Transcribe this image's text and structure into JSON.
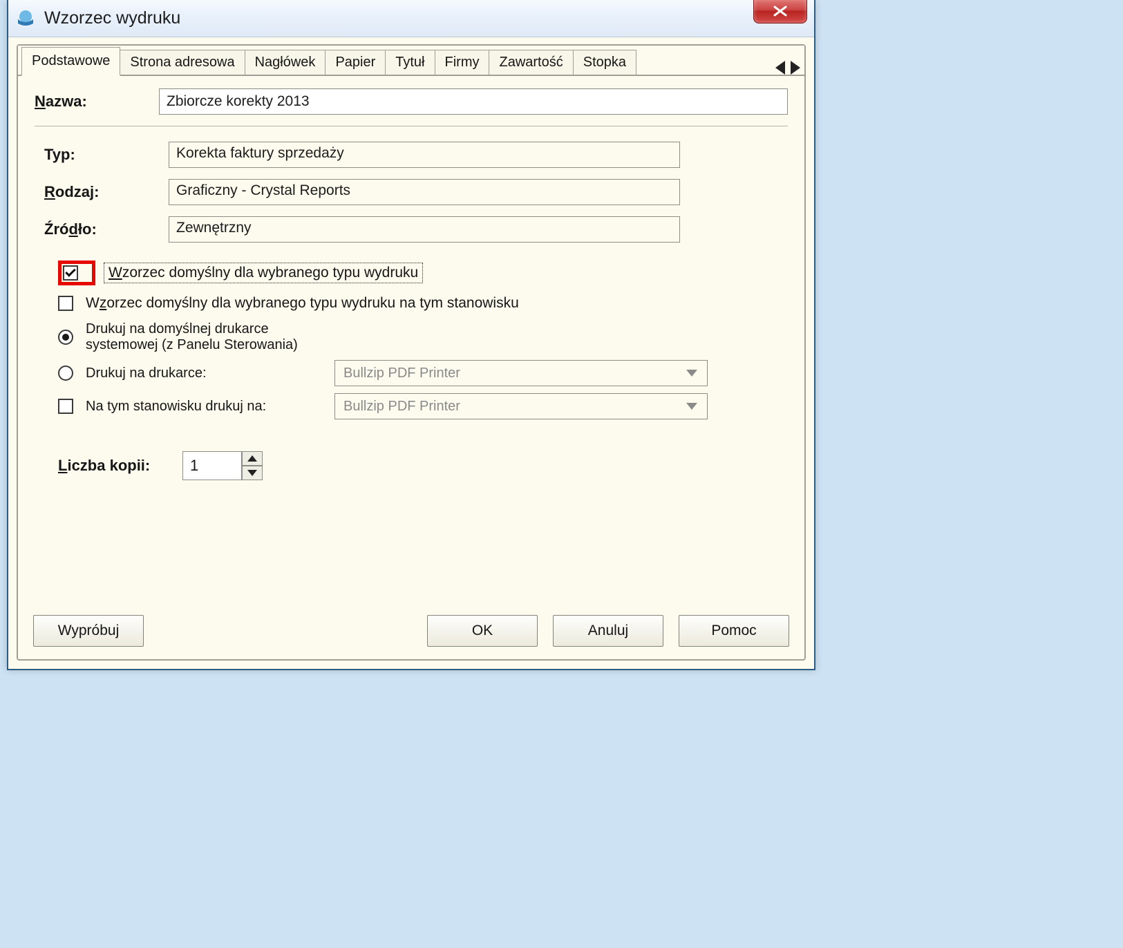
{
  "window": {
    "title": "Wzorzec wydruku"
  },
  "tabs": {
    "items": [
      "Podstawowe",
      "Strona adresowa",
      "Nagłówek",
      "Papier",
      "Tytuł",
      "Firmy",
      "Zawartość",
      "Stopka"
    ],
    "active": 0
  },
  "fields": {
    "nazwa_label": "Nazwa:",
    "nazwa_value": "Zbiorcze korekty 2013",
    "typ_label": "Typ:",
    "typ_value": "Korekta faktury sprzedaży",
    "rodzaj_label": "Rodzaj:",
    "rodzaj_value": "Graficzny - Crystal Reports",
    "zrodlo_label": "Źródło:",
    "zrodlo_value": "Zewnętrzny"
  },
  "checks": {
    "default_template": {
      "label": "Wzorzec domyślny dla wybranego typu wydruku",
      "checked": true
    },
    "default_template_station": {
      "label": "Wzorzec domyślny dla wybranego typu wydruku na tym stanowisku",
      "checked": false
    },
    "station_print_on": {
      "label": "Na tym stanowisku drukuj na:",
      "checked": false
    }
  },
  "radios": {
    "system_printer": {
      "label": "Drukuj na domyślnej drukarce systemowej (z Panelu Sterowania)",
      "selected": true
    },
    "named_printer": {
      "label": "Drukuj na drukarce:",
      "selected": false
    }
  },
  "combos": {
    "printer1": "Bullzip PDF Printer",
    "printer2": "Bullzip PDF Printer"
  },
  "copies": {
    "label": "Liczba kopii:",
    "value": "1"
  },
  "buttons": {
    "try": "Wypróbuj",
    "ok": "OK",
    "cancel": "Anuluj",
    "help": "Pomoc"
  }
}
